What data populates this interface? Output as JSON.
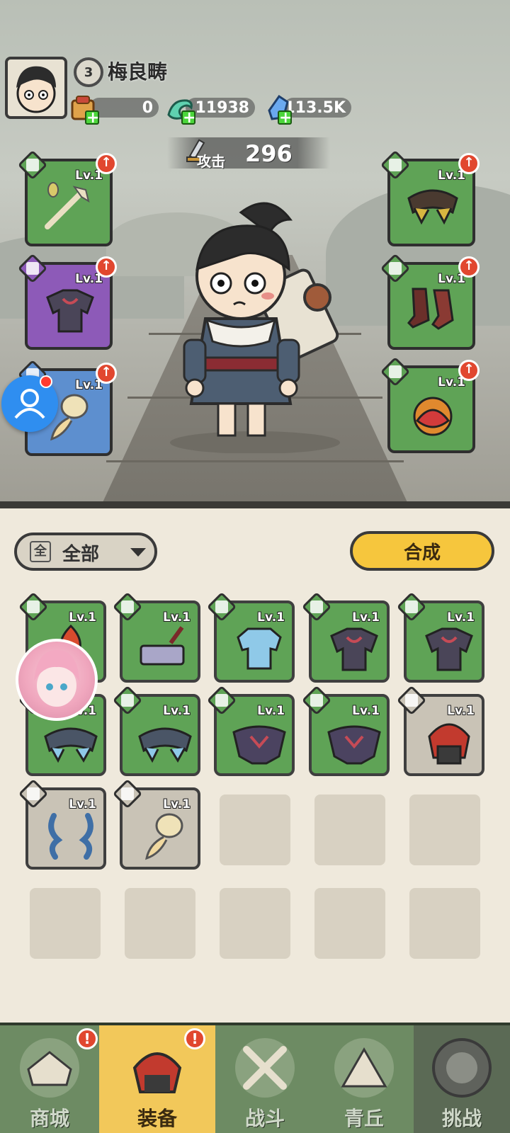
{
  "player": {
    "level": "3",
    "name": "梅良畴"
  },
  "resources": [
    {
      "icon": "scroll-bundle-icon",
      "value": "0"
    },
    {
      "icon": "jade-dragon-icon",
      "value": "11938"
    },
    {
      "icon": "blue-crystal-icon",
      "value": "113.5K"
    }
  ],
  "attack": {
    "label": "攻击",
    "value": "296"
  },
  "equipped": {
    "left": [
      {
        "level": "Lv.1",
        "type": "sword-icon",
        "item": "jade-staff-icon",
        "rarity": "green"
      },
      {
        "level": "Lv.1",
        "type": "armor-icon",
        "item": "dark-armor-icon",
        "rarity": "purple"
      },
      {
        "level": "Lv.1",
        "type": "ring-icon",
        "item": "feather-fan-icon",
        "rarity": "blue"
      }
    ],
    "right": [
      {
        "level": "Lv.1",
        "type": "belt-icon",
        "item": "shoulder-belt-icon",
        "rarity": "green"
      },
      {
        "level": "Lv.1",
        "type": "boots-icon",
        "item": "red-boots-icon",
        "rarity": "green"
      },
      {
        "level": "Lv.1",
        "type": "amulet-icon",
        "item": "lotus-orb-icon",
        "rarity": "green"
      }
    ]
  },
  "filter": {
    "icon_text": "全",
    "label": "全部"
  },
  "craft_button": "合成",
  "inventory": [
    {
      "level": "Lv.1",
      "item": "flame-weapon-icon",
      "rarity": "green"
    },
    {
      "level": "Lv.1",
      "item": "hammer-icon",
      "rarity": "green"
    },
    {
      "level": "Lv.1",
      "item": "ice-armor-icon",
      "rarity": "green"
    },
    {
      "level": "Lv.1",
      "item": "dark-armor-icon",
      "rarity": "green"
    },
    {
      "level": "Lv.1",
      "item": "dark-armor-icon",
      "rarity": "green"
    },
    {
      "level": "Lv.1",
      "item": "ice-belt-icon",
      "rarity": "green"
    },
    {
      "level": "Lv.1",
      "item": "ice-belt-icon",
      "rarity": "green"
    },
    {
      "level": "Lv.1",
      "item": "dark-belt-icon",
      "rarity": "green"
    },
    {
      "level": "Lv.1",
      "item": "dark-belt-icon",
      "rarity": "green"
    },
    {
      "level": "Lv.1",
      "item": "red-helmet-icon",
      "rarity": "grey"
    },
    {
      "level": "Lv.1",
      "item": "blue-horns-icon",
      "rarity": "grey"
    },
    {
      "level": "Lv.1",
      "item": "feather-fan-icon",
      "rarity": "grey"
    }
  ],
  "nav": [
    {
      "label": "商城",
      "icon": "shop-icon",
      "alert": "!"
    },
    {
      "label": "装备",
      "icon": "equipment-helmet-icon",
      "alert": "!",
      "active": true
    },
    {
      "label": "战斗",
      "icon": "crossed-swords-icon"
    },
    {
      "label": "青丘",
      "icon": "mountain-icon"
    },
    {
      "label": "挑战",
      "icon": "challenge-orb-icon"
    }
  ],
  "colors": {
    "green": "#5fa356",
    "purple": "#8d5ab8",
    "blue": "#5d8fcf",
    "grey": "#c9c3b6",
    "craft": "#f6c63d",
    "nav_active": "#f2c85a",
    "nav_bg": "#6d8b63"
  }
}
